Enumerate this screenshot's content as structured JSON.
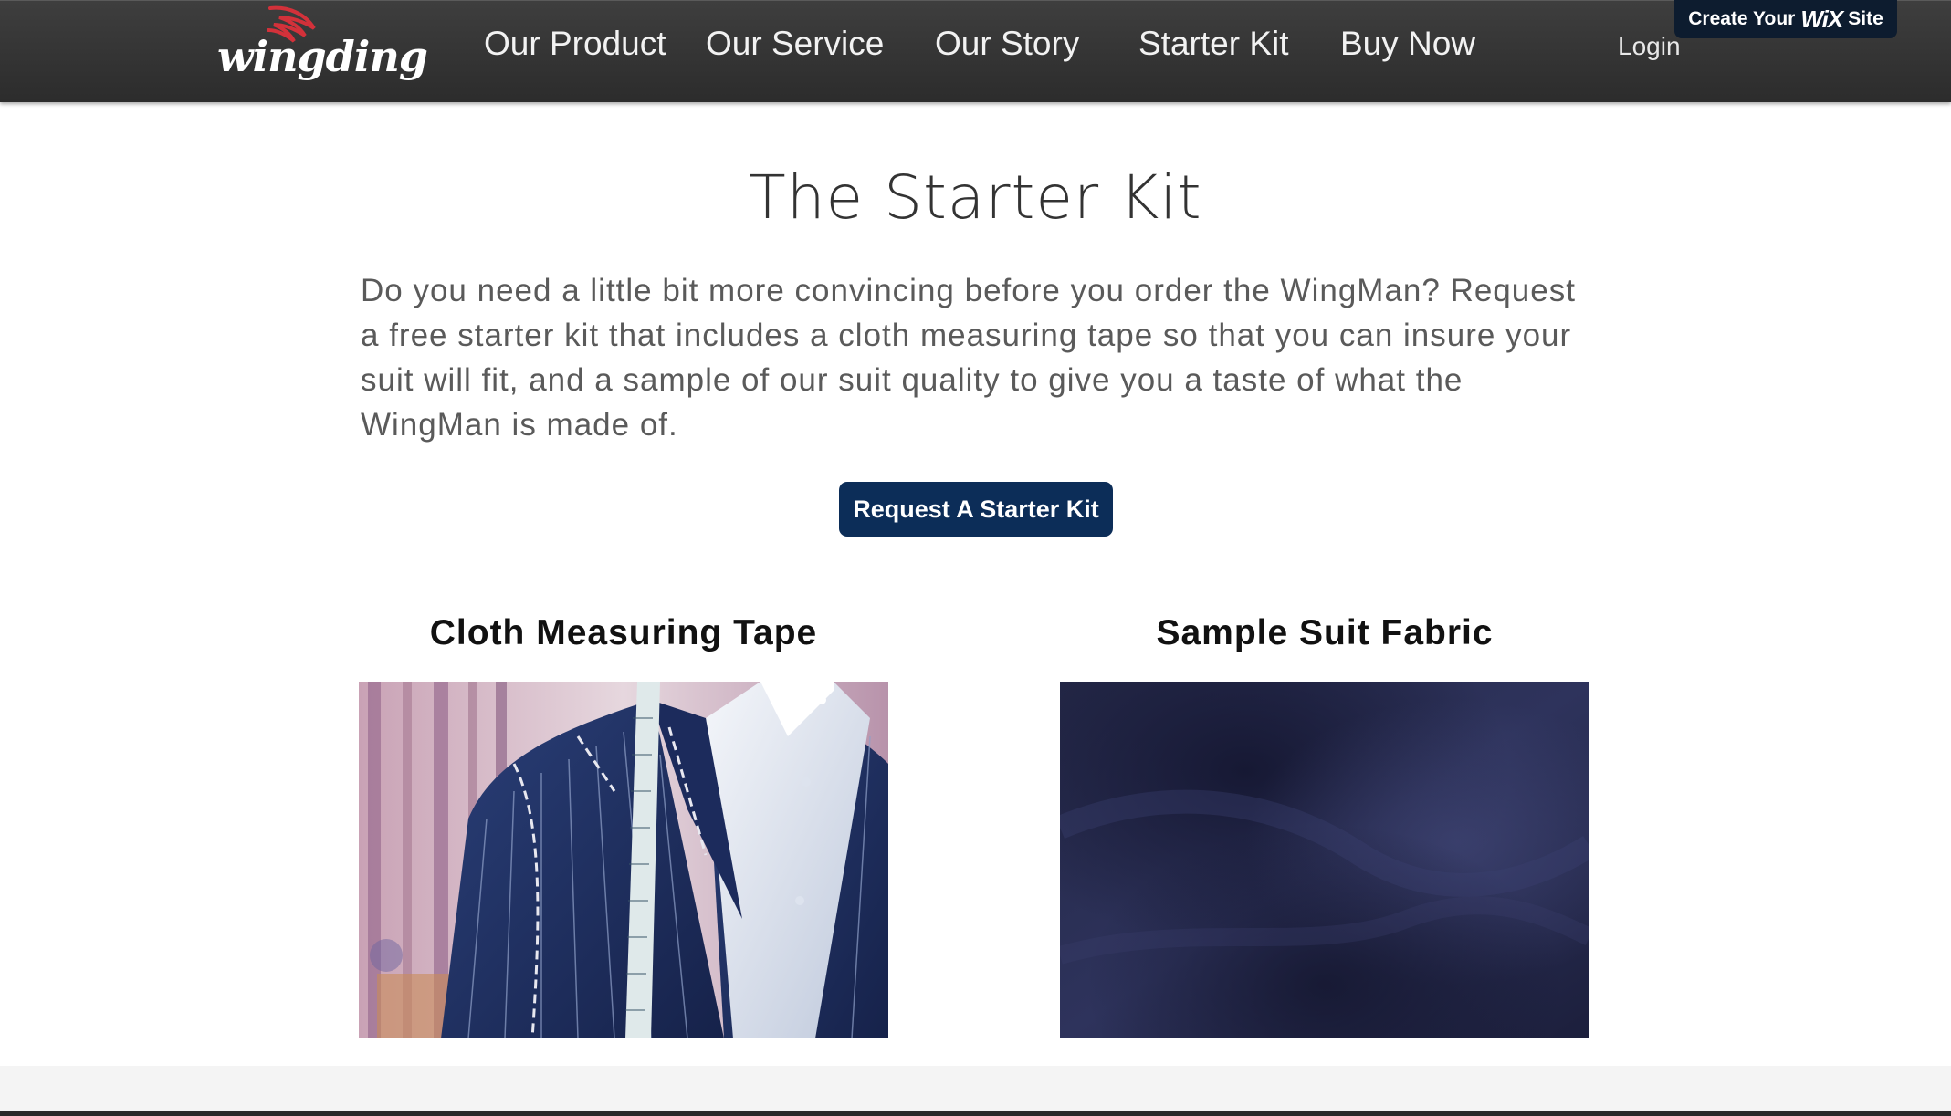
{
  "header": {
    "logo_text": "wingding",
    "nav": [
      "Our Product",
      "Our Service",
      "Our Story",
      "Starter Kit",
      "Buy Now"
    ],
    "login_label": "Login",
    "wix_banner": {
      "prefix": "Create Your",
      "brand": "WiX",
      "suffix": "Site"
    }
  },
  "main": {
    "title": "The Starter Kit",
    "intro": "Do you need a little bit more convincing before you order the WingMan? Request a free starter kit that includes a cloth measuring tape so that you can insure your suit will fit, and a sample of our suit quality to give you a taste of what the WingMan is made of.",
    "cta_label": "Request A Starter Kit",
    "cards": [
      {
        "title": "Cloth Measuring Tape"
      },
      {
        "title": "Sample Suit Fabric"
      }
    ]
  },
  "colors": {
    "header_bg": "#333333",
    "cta_bg": "#0c2d58",
    "wix_banner_bg": "#0d1c2f",
    "logo_accent": "#d3313a"
  }
}
